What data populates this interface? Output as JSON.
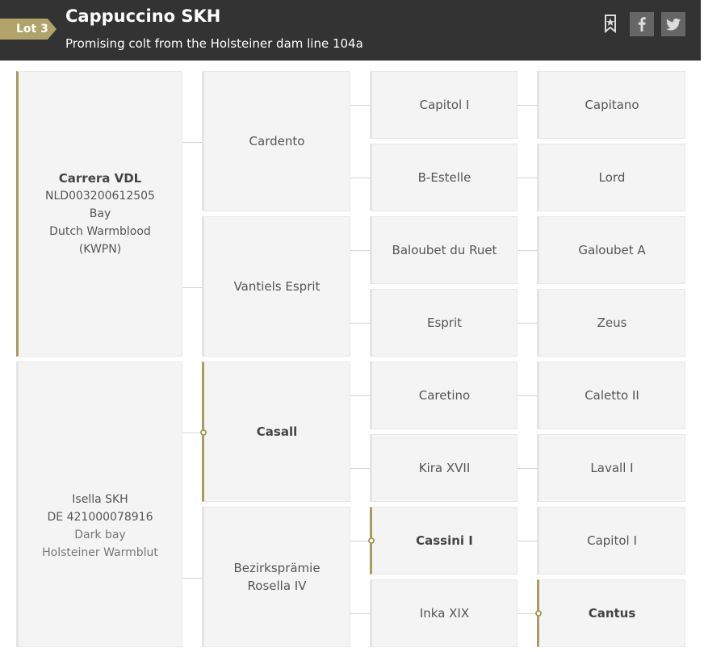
{
  "header": {
    "lot": "Lot 3",
    "title": "Cappuccino SKH",
    "subtitle": "Promising colt from the Holsteiner dam line 104a",
    "icons": [
      "bookmark-star-icon",
      "facebook-icon",
      "twitter-icon"
    ]
  },
  "pedigree": {
    "sire": {
      "name": "Carrera VDL",
      "details": [
        "NLD003200612505",
        "Bay",
        "Dutch Warmblood (KWPN)"
      ]
    },
    "dam": {
      "name": "Isella SKH",
      "details": [
        "DE 421000078916",
        "Dark bay",
        "Holsteiner Warmblut"
      ]
    },
    "gen2": [
      "Cardento",
      "Vantiels Esprit",
      "Casall",
      "Bezirksprämie Rosella IV"
    ],
    "gen3": [
      "Capitol I",
      "B-Estelle",
      "Baloubet du Ruet",
      "Esprit",
      "Caretino",
      "Kira XVII",
      "Cassini I",
      "Inka XIX"
    ],
    "gen4": [
      "Capitano",
      "Lord",
      "Galoubet A",
      "Zeus",
      "Caletto II",
      "Lavall I",
      "Capitol I",
      "Cantus"
    ]
  },
  "colors": {
    "header_bg": "#333333",
    "accent": "#a99c5f",
    "card_bg": "#f4f4f4"
  }
}
